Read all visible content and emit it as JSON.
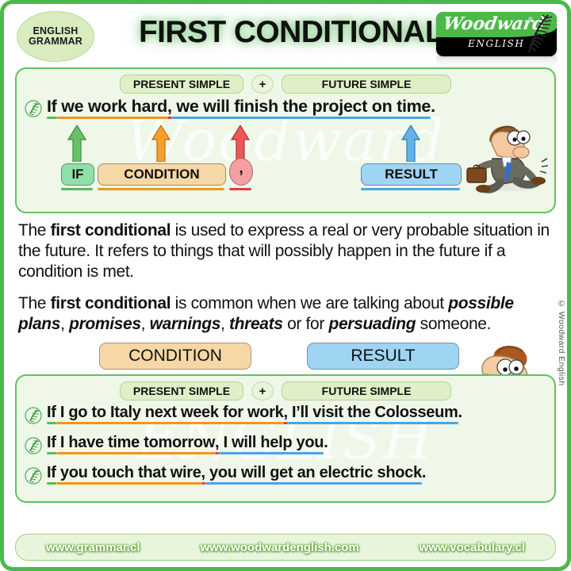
{
  "header": {
    "badge_line1": "ENGLISH",
    "badge_line2": "GRAMMAR",
    "title": "FIRST CONDITIONAL",
    "logo_word": "Woodward",
    "logo_reg": "®",
    "logo_sub": "ENGLISH"
  },
  "top_box": {
    "chip_left": "PRESENT SIMPLE",
    "plus": "+",
    "chip_right": "FUTURE SIMPLE",
    "sentence": {
      "if": "If",
      "condition": " we work hard",
      "comma": ",",
      "result": " we will finish the project on time",
      "period": "."
    },
    "labels": {
      "if": "IF",
      "condition": "CONDITION",
      "comma": ",",
      "result": "RESULT"
    },
    "watermark": "Woodward"
  },
  "paragraph1": {
    "p1_a": "The ",
    "p1_b": "first conditional",
    "p1_c": " is used to express a real or very probable situation in the future. It refers to things that will possibly happen in the future if a condition is met."
  },
  "paragraph2": {
    "a": "The ",
    "b": "first conditional",
    "c": " is common when we are talking about ",
    "d": "possible plans",
    "e": ", ",
    "f": "promises",
    "g": ", ",
    "h": "warnings",
    "i": ", ",
    "j": "threats",
    "k": " or for ",
    "l": "persuading",
    "m": " someone."
  },
  "mid_labels": {
    "condition": "CONDITION",
    "result": "RESULT"
  },
  "bottom_box": {
    "chip_left": "PRESENT SIMPLE",
    "plus": "+",
    "chip_right": "FUTURE SIMPLE",
    "watermark": "ENGLISH",
    "examples": [
      {
        "if": "If",
        "condition": " I go to Italy next week for work",
        "comma": ",",
        "result": " I’ll visit the Colosseum",
        "period": "."
      },
      {
        "if": "If",
        "condition": " I have time tomorrow",
        "comma": ",",
        "result": " I will help you",
        "period": "."
      },
      {
        "if": "If",
        "condition": " you touch that wire",
        "comma": ",",
        "result": " you will get an electric shock",
        "period": "."
      }
    ]
  },
  "copyright": "© Woodward English",
  "footer": {
    "link1": "www.grammar.cl",
    "link2": "www.woodwardenglish.com",
    "link3": "www.vocabulary.cl"
  },
  "colors": {
    "green": "#5cb85c",
    "orange": "#f0951e",
    "red": "#ea3b3b",
    "blue": "#4aa3e8",
    "border_green": "#49b949",
    "box_bg": "#eef7e8",
    "chip_green": "#dff0c8",
    "if_chip": "#8fe0a6",
    "condition_chip": "#f6d7a6",
    "comma_chip": "#f5a0a0",
    "result_chip": "#9fd4f2"
  }
}
